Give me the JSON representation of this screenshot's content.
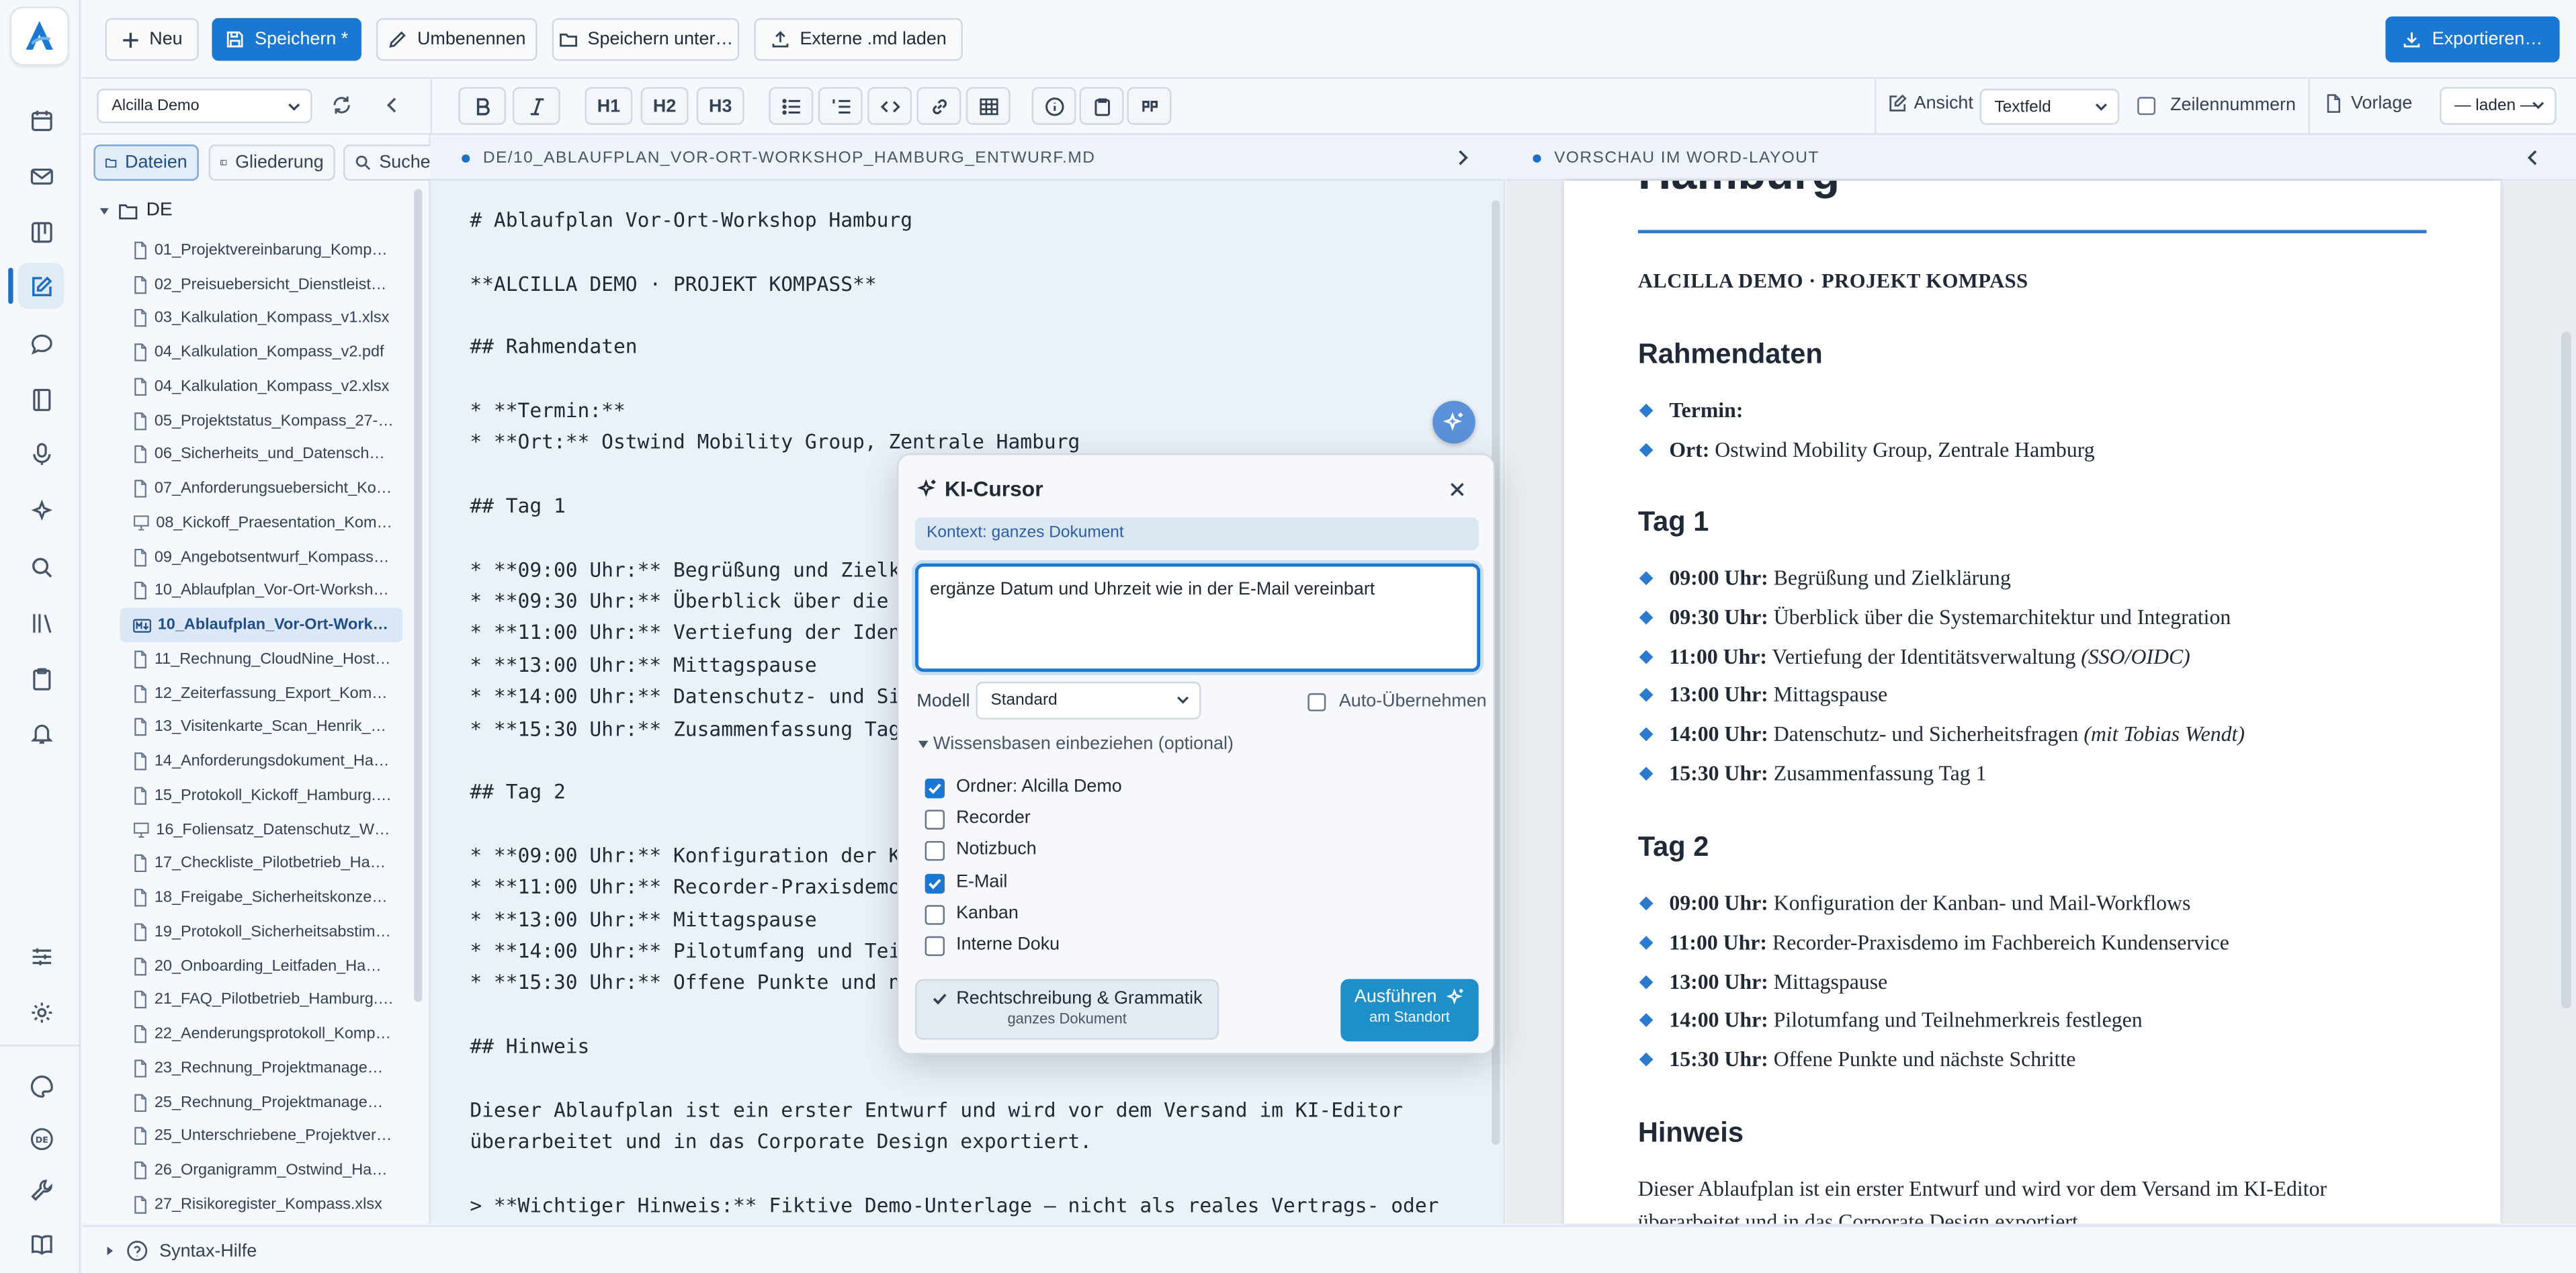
{
  "toolbar": {
    "new_label": "Neu",
    "save_label": "Speichern *",
    "rename_label": "Umbenennen",
    "save_as_label": "Speichern unter…",
    "load_md_label": "Externe .md laden",
    "export_label": "Exportieren…"
  },
  "format_bar": {
    "h1": "H1",
    "h2": "H2",
    "h3": "H3",
    "view_label": "Ansicht",
    "view_value": "Textfeld",
    "line_numbers_label": "Zeilennummern",
    "template_label": "Vorlage",
    "template_value": "— laden —"
  },
  "sidebar": {
    "workspace": "Alcilla Demo",
    "tabs": [
      "Dateien",
      "Gliederung",
      "Suche"
    ],
    "folder": "DE",
    "files": [
      {
        "name": "01_Projektvereinbarung_Komp…",
        "icon": "doc"
      },
      {
        "name": "02_Preisuebersicht_Dienstleist…",
        "icon": "doc"
      },
      {
        "name": "03_Kalkulation_Kompass_v1.xlsx",
        "icon": "doc"
      },
      {
        "name": "04_Kalkulation_Kompass_v2.pdf",
        "icon": "doc"
      },
      {
        "name": "04_Kalkulation_Kompass_v2.xlsx",
        "icon": "doc"
      },
      {
        "name": "05_Projektstatus_Kompass_27-…",
        "icon": "doc"
      },
      {
        "name": "06_Sicherheits_und_Datensch…",
        "icon": "doc"
      },
      {
        "name": "07_Anforderungsuebersicht_Ko…",
        "icon": "doc"
      },
      {
        "name": "08_Kickoff_Praesentation_Kom…",
        "icon": "slides"
      },
      {
        "name": "09_Angebotsentwurf_Kompass…",
        "icon": "doc"
      },
      {
        "name": "10_Ablaufplan_Vor-Ort-Worksh…",
        "icon": "doc"
      },
      {
        "name": "10_Ablaufplan_Vor-Ort-Work…",
        "icon": "md",
        "active": true
      },
      {
        "name": "11_Rechnung_CloudNine_Host…",
        "icon": "doc"
      },
      {
        "name": "12_Zeiterfassung_Export_Kom…",
        "icon": "doc"
      },
      {
        "name": "13_Visitenkarte_Scan_Henrik_…",
        "icon": "doc"
      },
      {
        "name": "14_Anforderungsdokument_Ha…",
        "icon": "doc"
      },
      {
        "name": "15_Protokoll_Kickoff_Hamburg.…",
        "icon": "doc"
      },
      {
        "name": "16_Foliensatz_Datenschutz_W…",
        "icon": "slides"
      },
      {
        "name": "17_Checkliste_Pilotbetrieb_Ha…",
        "icon": "doc"
      },
      {
        "name": "18_Freigabe_Sicherheitskonze…",
        "icon": "doc"
      },
      {
        "name": "19_Protokoll_Sicherheitsabstim…",
        "icon": "doc"
      },
      {
        "name": "20_Onboarding_Leitfaden_Ha…",
        "icon": "doc"
      },
      {
        "name": "21_FAQ_Pilotbetrieb_Hamburg.…",
        "icon": "doc"
      },
      {
        "name": "22_Aenderungsprotokoll_Komp…",
        "icon": "doc"
      },
      {
        "name": "23_Rechnung_Projektmanage…",
        "icon": "doc"
      },
      {
        "name": "25_Rechnung_Projektmanage…",
        "icon": "doc"
      },
      {
        "name": "25_Unterschriebene_Projektver…",
        "icon": "doc"
      },
      {
        "name": "26_Organigramm_Ostwind_Ha…",
        "icon": "doc"
      },
      {
        "name": "27_Risikoregister_Kompass.xlsx",
        "icon": "doc"
      }
    ]
  },
  "editor": {
    "path": "DE/10_ABLAUFPLAN_VOR-ORT-WORKSHOP_HAMBURG_ENTWURF.MD",
    "lines": [
      "# Ablaufplan Vor-Ort-Workshop Hamburg",
      "",
      "**ALCILLA DEMO · PROJEKT KOMPASS**",
      "",
      "## Rahmendaten",
      "",
      "* **Termin:**",
      "* **Ort:** Ostwind Mobility Group, Zentrale Hamburg",
      "",
      "## Tag 1",
      "",
      "* **09:00 Uhr:** Begrüßung und Zielkl",
      "* **09:30 Uhr:** Überblick über die S",
      "* **11:00 Uhr:** Vertiefung der Ident",
      "* **13:00 Uhr:** Mittagspause",
      "* **14:00 Uhr:** Datenschutz- und Sic",
      "* **15:30 Uhr:** Zusammenfassung Tag",
      "",
      "## Tag 2",
      "",
      "* **09:00 Uhr:** Konfiguration der Ka",
      "* **11:00 Uhr:** Recorder-Praxisdemo",
      "* **13:00 Uhr:** Mittagspause",
      "* **14:00 Uhr:** Pilotumfang und Teil",
      "* **15:30 Uhr:** Offene Punkte und nä",
      "",
      "## Hinweis",
      "",
      "Dieser Ablaufplan ist ein erster Entwurf und wird vor dem Versand im KI-Editor",
      "überarbeitet und in das Corporate Design exportiert.",
      "",
      "> **Wichtiger Hinweis:** Fiktive Demo-Unterlage – nicht als reales Vertrags- oder"
    ]
  },
  "preview": {
    "header": "VORSCHAU IM WORD-LAYOUT",
    "title_fragment": "Hamburg",
    "subtitle": "ALCILLA DEMO · PROJEKT KOMPASS",
    "h_rahmen": "Rahmendaten",
    "rahmen": [
      {
        "b": "Termin:",
        "t": ""
      },
      {
        "b": "Ort:",
        "t": " Ostwind Mobility Group, Zentrale Hamburg"
      }
    ],
    "h_tag1": "Tag 1",
    "tag1": [
      {
        "b": "09:00 Uhr:",
        "t": " Begrüßung und Zielklärung",
        "i": ""
      },
      {
        "b": "09:30 Uhr:",
        "t": " Überblick über die Systemarchitektur und Integration",
        "i": ""
      },
      {
        "b": "11:00 Uhr:",
        "t": " Vertiefung der Identitätsverwaltung ",
        "i": "(SSO/OIDC)"
      },
      {
        "b": "13:00 Uhr:",
        "t": " Mittagspause",
        "i": ""
      },
      {
        "b": "14:00 Uhr:",
        "t": " Datenschutz- und Sicherheitsfragen ",
        "i": "(mit Tobias Wendt)"
      },
      {
        "b": "15:30 Uhr:",
        "t": " Zusammenfassung Tag 1",
        "i": ""
      }
    ],
    "h_tag2": "Tag 2",
    "tag2": [
      {
        "b": "09:00 Uhr:",
        "t": " Konfiguration der Kanban- und Mail-Workflows",
        "i": ""
      },
      {
        "b": "11:00 Uhr:",
        "t": " Recorder-Praxisdemo im Fachbereich Kundenservice",
        "i": ""
      },
      {
        "b": "13:00 Uhr:",
        "t": " Mittagspause",
        "i": ""
      },
      {
        "b": "14:00 Uhr:",
        "t": " Pilotumfang und Teilnehmerkreis festlegen",
        "i": ""
      },
      {
        "b": "15:30 Uhr:",
        "t": " Offene Punkte und nächste Schritte",
        "i": ""
      }
    ],
    "h_hinweis": "Hinweis",
    "hinweis_1": "Dieser Ablaufplan ist ein erster Entwurf und wird vor dem Versand im KI-Editor",
    "hinweis_2": "überarbeitet und in das Corporate Design exportiert."
  },
  "ki_cursor": {
    "title": "KI-Cursor",
    "context": "Kontext: ganzes Dokument",
    "prompt": "ergänze Datum und Uhrzeit wie in der E-Mail vereinbart",
    "model_label": "Modell",
    "model_value": "Standard",
    "auto_apply_label": "Auto-Übernehmen",
    "kb_toggle": "Wissensbasen einbeziehen (optional)",
    "kbs": [
      {
        "label": "Ordner: Alcilla Demo",
        "checked": true
      },
      {
        "label": "Recorder",
        "checked": false
      },
      {
        "label": "Notizbuch",
        "checked": false
      },
      {
        "label": "E-Mail",
        "checked": true
      },
      {
        "label": "Kanban",
        "checked": false
      },
      {
        "label": "Interne Doku",
        "checked": false
      }
    ],
    "spell_label": "Rechtschreibung & Grammatik",
    "spell_sub": "ganzes Dokument",
    "run_label": "Ausführen",
    "run_sub": "am Standort"
  },
  "status": {
    "syntax_help": "Syntax-Hilfe"
  },
  "colors": {
    "accent": "#1a77d2",
    "bullet": "#2a7bd0",
    "dialog_button": "#1f8fc9"
  }
}
